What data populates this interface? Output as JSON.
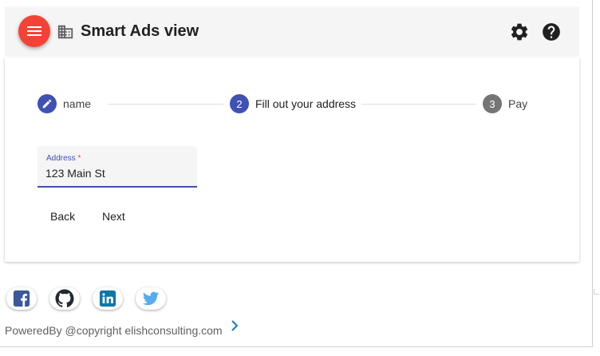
{
  "header": {
    "title": "Smart Ads view",
    "menu_icon": "hamburger-menu-icon",
    "title_icon": "building-icon",
    "settings_icon": "gear-icon",
    "help_icon": "help-circle-icon"
  },
  "stepper": {
    "steps": [
      {
        "indicator": "",
        "icon": "pencil-icon",
        "label": "name",
        "state": "edit"
      },
      {
        "indicator": "2",
        "label": "Fill out your address",
        "state": "active"
      },
      {
        "indicator": "3",
        "label": "Pay",
        "state": "inactive"
      }
    ]
  },
  "form": {
    "address": {
      "label": "Address",
      "required_mark": "*",
      "value": "123 Main St",
      "placeholder": ""
    },
    "back_label": "Back",
    "next_label": "Next"
  },
  "social": {
    "links": [
      {
        "name": "facebook-icon",
        "color": "#3b5998"
      },
      {
        "name": "github-icon",
        "color": "#24292e"
      },
      {
        "name": "linkedin-icon",
        "color": "#0e76a8"
      },
      {
        "name": "twitter-icon",
        "color": "#55acee"
      }
    ]
  },
  "footer": {
    "text": "PoweredBy @copyright elishconsulting.com",
    "chevron_icon": "chevron-right-icon"
  },
  "colors": {
    "primary": "#3f51b5",
    "accent": "#f44336",
    "inactive_step": "#757575",
    "toolbar_bg": "#f5f5f5"
  }
}
